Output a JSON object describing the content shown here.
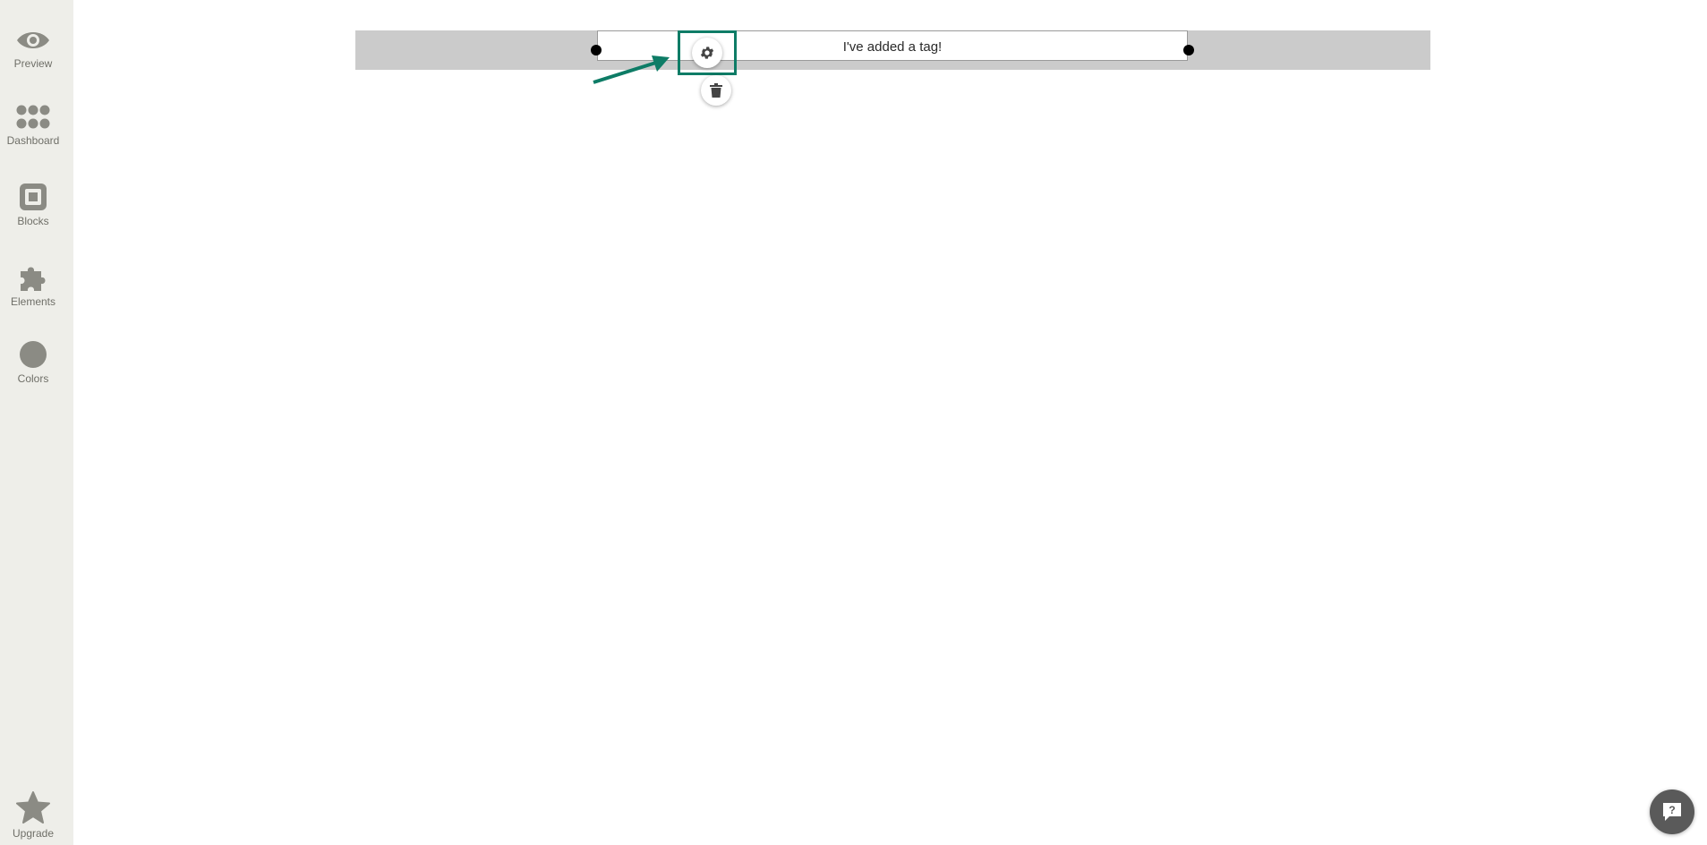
{
  "sidebar": {
    "items": [
      {
        "label": "Preview",
        "icon": "eye-icon"
      },
      {
        "label": "Dashboard",
        "icon": "dots-grid-icon"
      },
      {
        "label": "Blocks",
        "icon": "square-block-icon"
      },
      {
        "label": "Elements",
        "icon": "puzzle-icon"
      },
      {
        "label": "Colors",
        "icon": "circle-icon"
      }
    ],
    "upgrade": {
      "label": "Upgrade",
      "icon": "star-icon"
    }
  },
  "canvas": {
    "tag_text": "I've added a tag!",
    "settings_icon": "gear-icon",
    "delete_icon": "trash-icon"
  },
  "help": {
    "icon": "chat-question-icon"
  },
  "colors": {
    "sidebar_bg": "#eeeee9",
    "icon_gray": "#8b8b84",
    "highlight": "#0e7c66",
    "banner": "#cbcbcb"
  }
}
